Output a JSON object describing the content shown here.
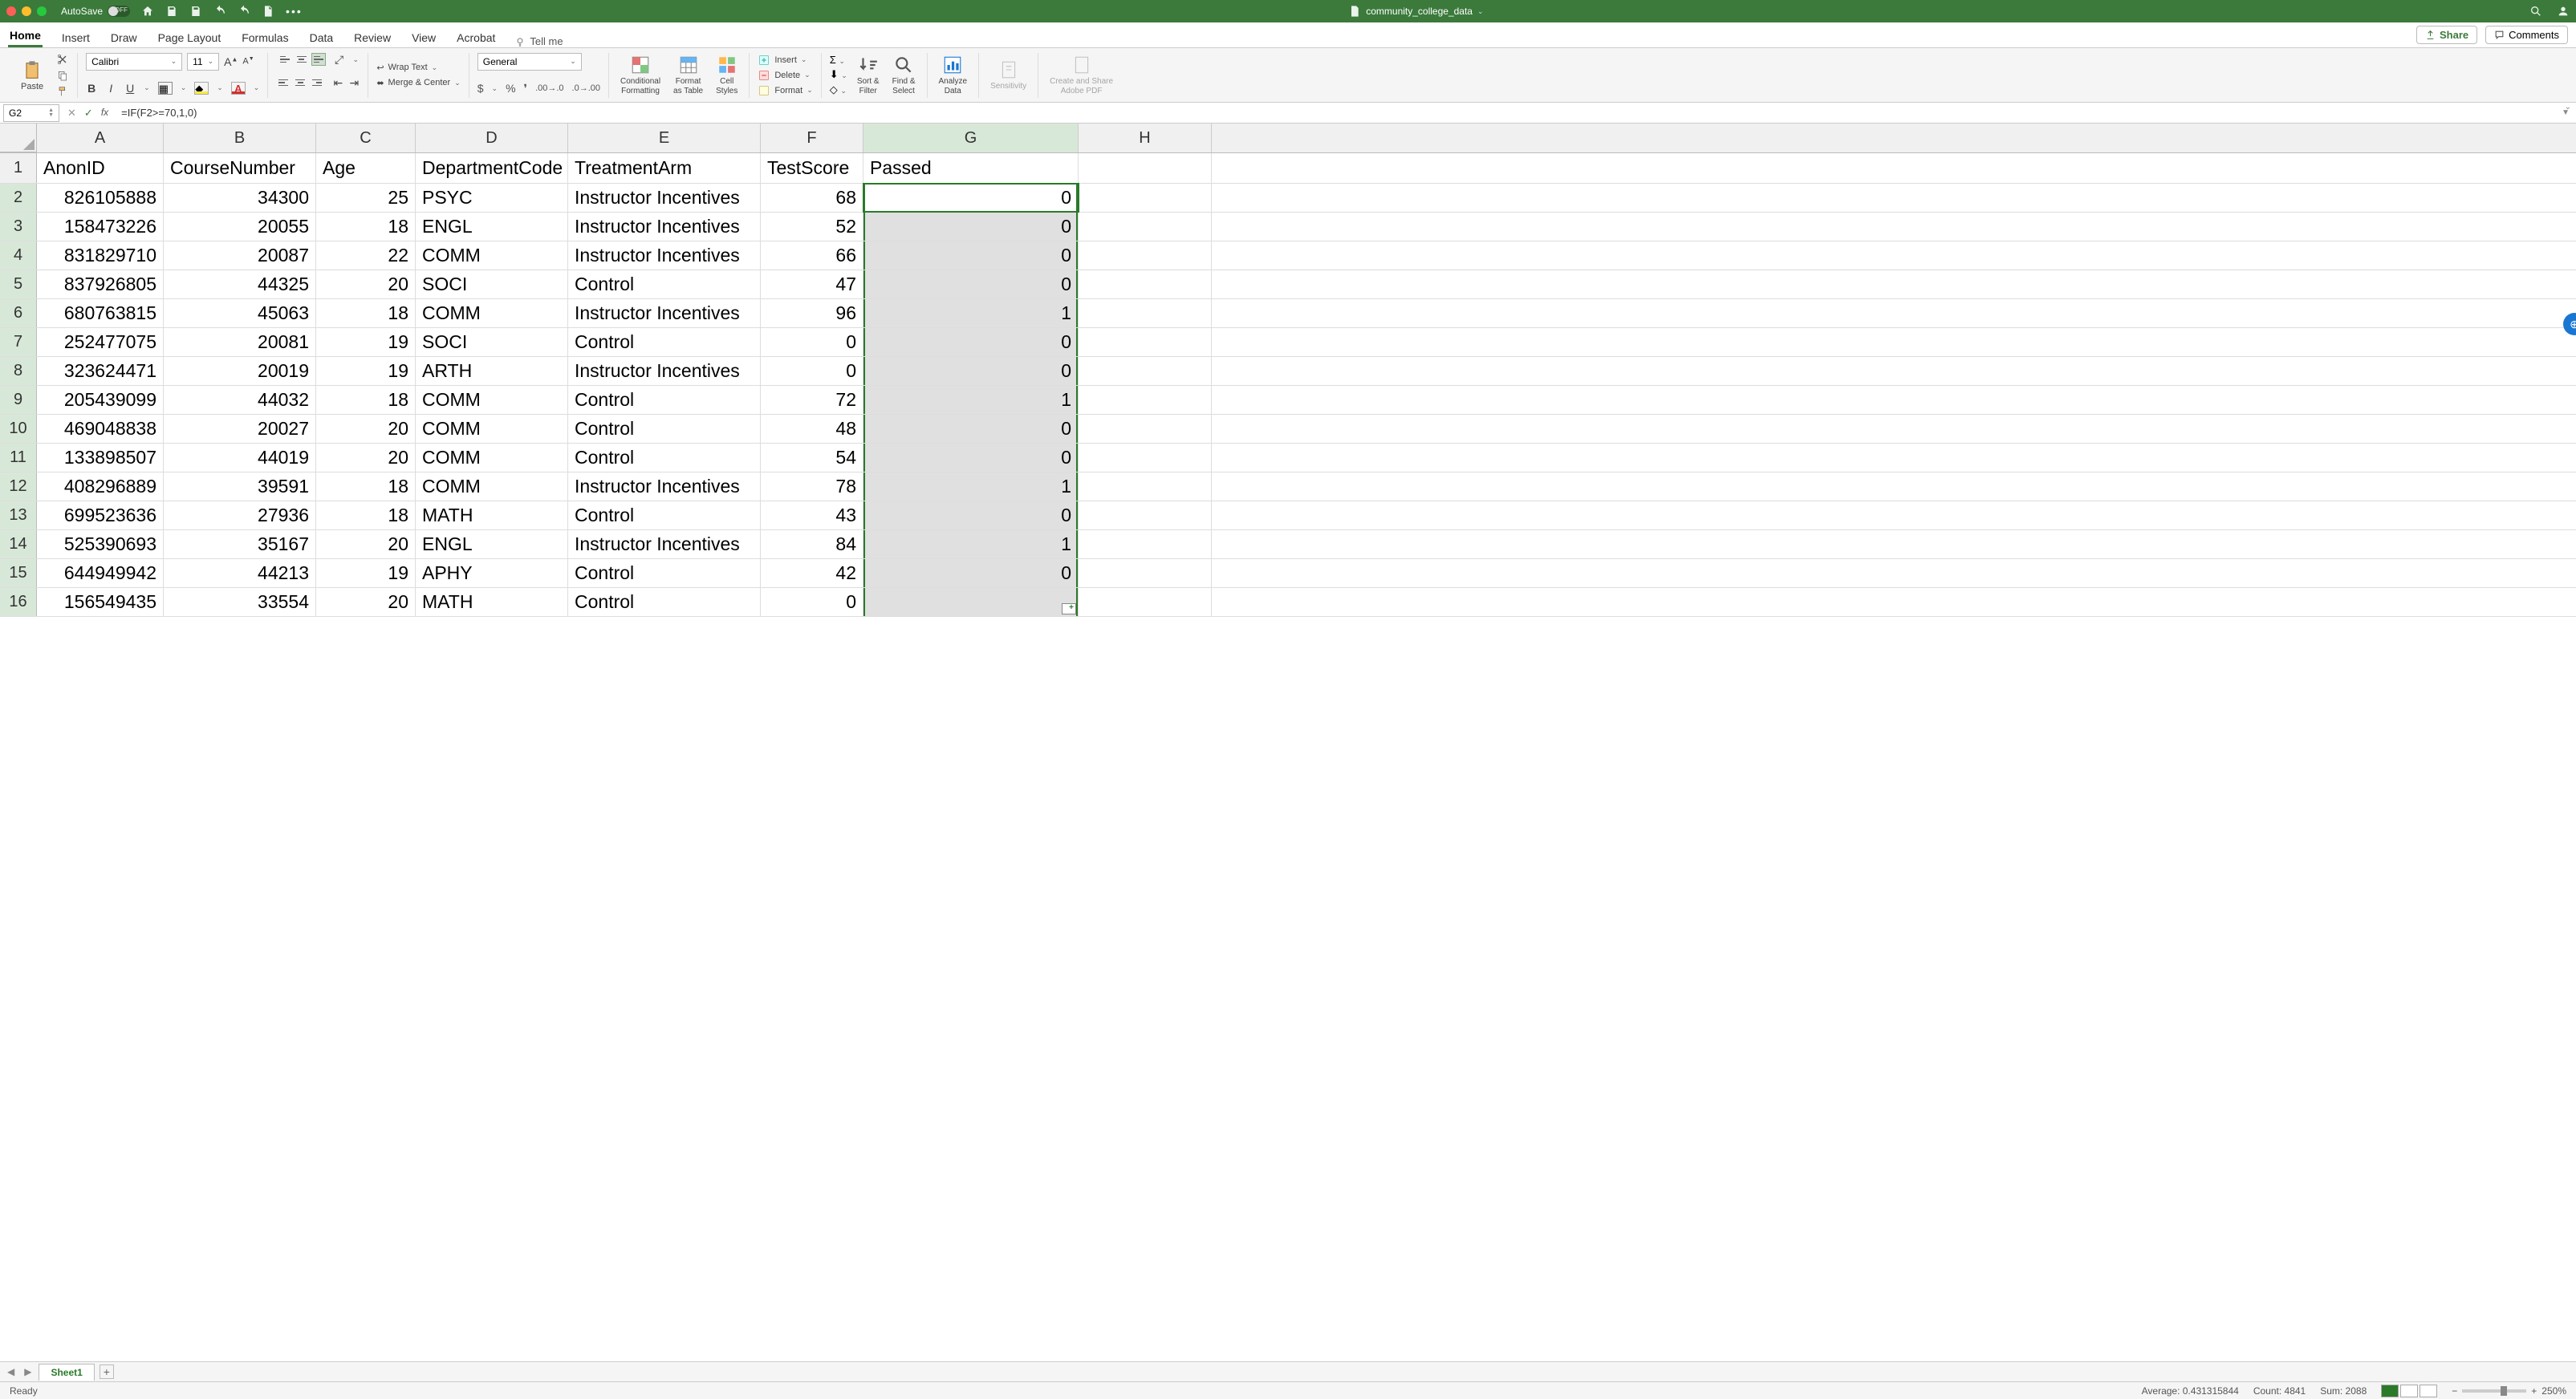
{
  "titlebar": {
    "autosave_label": "AutoSave",
    "autosave_state": "OFF",
    "filename": "community_college_data"
  },
  "tabs": [
    "Home",
    "Insert",
    "Draw",
    "Page Layout",
    "Formulas",
    "Data",
    "Review",
    "View",
    "Acrobat"
  ],
  "active_tab": "Home",
  "tellme": "Tell me",
  "share": "Share",
  "comments": "Comments",
  "ribbon": {
    "paste": "Paste",
    "font_name": "Calibri",
    "font_size": "11",
    "wrap": "Wrap Text",
    "merge": "Merge & Center",
    "num_format": "General",
    "cond_fmt": "Conditional\nFormatting",
    "fmt_table": "Format\nas Table",
    "cell_styles": "Cell\nStyles",
    "insert": "Insert",
    "delete": "Delete",
    "format": "Format",
    "sort_filter": "Sort &\nFilter",
    "find_select": "Find &\nSelect",
    "analyze": "Analyze\nData",
    "sensitivity": "Sensitivity",
    "adobe": "Create and Share\nAdobe PDF"
  },
  "namebox": "G2",
  "formula": "=IF(F2>=70,1,0)",
  "columns": [
    "A",
    "B",
    "C",
    "D",
    "E",
    "F",
    "G",
    "H"
  ],
  "col_widths": [
    "cA",
    "cB",
    "cC",
    "cD",
    "cE",
    "cF",
    "cG",
    "cH"
  ],
  "selected_col": "G",
  "headers": [
    "AnonID",
    "CourseNumber",
    "Age",
    "DepartmentCode",
    "TreatmentArm",
    "TestScore",
    "Passed",
    ""
  ],
  "rows": [
    {
      "r": 2,
      "d": [
        "826105888",
        "34300",
        "25",
        "PSYC",
        "Instructor Incentives",
        "68",
        "0",
        ""
      ]
    },
    {
      "r": 3,
      "d": [
        "158473226",
        "20055",
        "18",
        "ENGL",
        "Instructor Incentives",
        "52",
        "0",
        ""
      ]
    },
    {
      "r": 4,
      "d": [
        "831829710",
        "20087",
        "22",
        "COMM",
        "Instructor Incentives",
        "66",
        "0",
        ""
      ]
    },
    {
      "r": 5,
      "d": [
        "837926805",
        "44325",
        "20",
        "SOCI",
        "Control",
        "47",
        "0",
        ""
      ]
    },
    {
      "r": 6,
      "d": [
        "680763815",
        "45063",
        "18",
        "COMM",
        "Instructor Incentives",
        "96",
        "1",
        ""
      ]
    },
    {
      "r": 7,
      "d": [
        "252477075",
        "20081",
        "19",
        "SOCI",
        "Control",
        "0",
        "0",
        ""
      ]
    },
    {
      "r": 8,
      "d": [
        "323624471",
        "20019",
        "19",
        "ARTH",
        "Instructor Incentives",
        "0",
        "0",
        ""
      ]
    },
    {
      "r": 9,
      "d": [
        "205439099",
        "44032",
        "18",
        "COMM",
        "Control",
        "72",
        "1",
        ""
      ]
    },
    {
      "r": 10,
      "d": [
        "469048838",
        "20027",
        "20",
        "COMM",
        "Control",
        "48",
        "0",
        ""
      ]
    },
    {
      "r": 11,
      "d": [
        "133898507",
        "44019",
        "20",
        "COMM",
        "Control",
        "54",
        "0",
        ""
      ]
    },
    {
      "r": 12,
      "d": [
        "408296889",
        "39591",
        "18",
        "COMM",
        "Instructor Incentives",
        "78",
        "1",
        ""
      ]
    },
    {
      "r": 13,
      "d": [
        "699523636",
        "27936",
        "18",
        "MATH",
        "Control",
        "43",
        "0",
        ""
      ]
    },
    {
      "r": 14,
      "d": [
        "525390693",
        "35167",
        "20",
        "ENGL",
        "Instructor Incentives",
        "84",
        "1",
        ""
      ]
    },
    {
      "r": 15,
      "d": [
        "644949942",
        "44213",
        "19",
        "APHY",
        "Control",
        "42",
        "0",
        ""
      ]
    },
    {
      "r": 16,
      "d": [
        "156549435",
        "33554",
        "20",
        "MATH",
        "Control",
        "0",
        "",
        ""
      ]
    }
  ],
  "col_align": [
    "num",
    "num",
    "num",
    "txt",
    "txt",
    "num",
    "num",
    "txt"
  ],
  "sheet": "Sheet1",
  "status": {
    "ready": "Ready",
    "avg": "Average: 0.431315844",
    "count": "Count: 4841",
    "sum": "Sum: 2088",
    "zoom": "250%"
  }
}
